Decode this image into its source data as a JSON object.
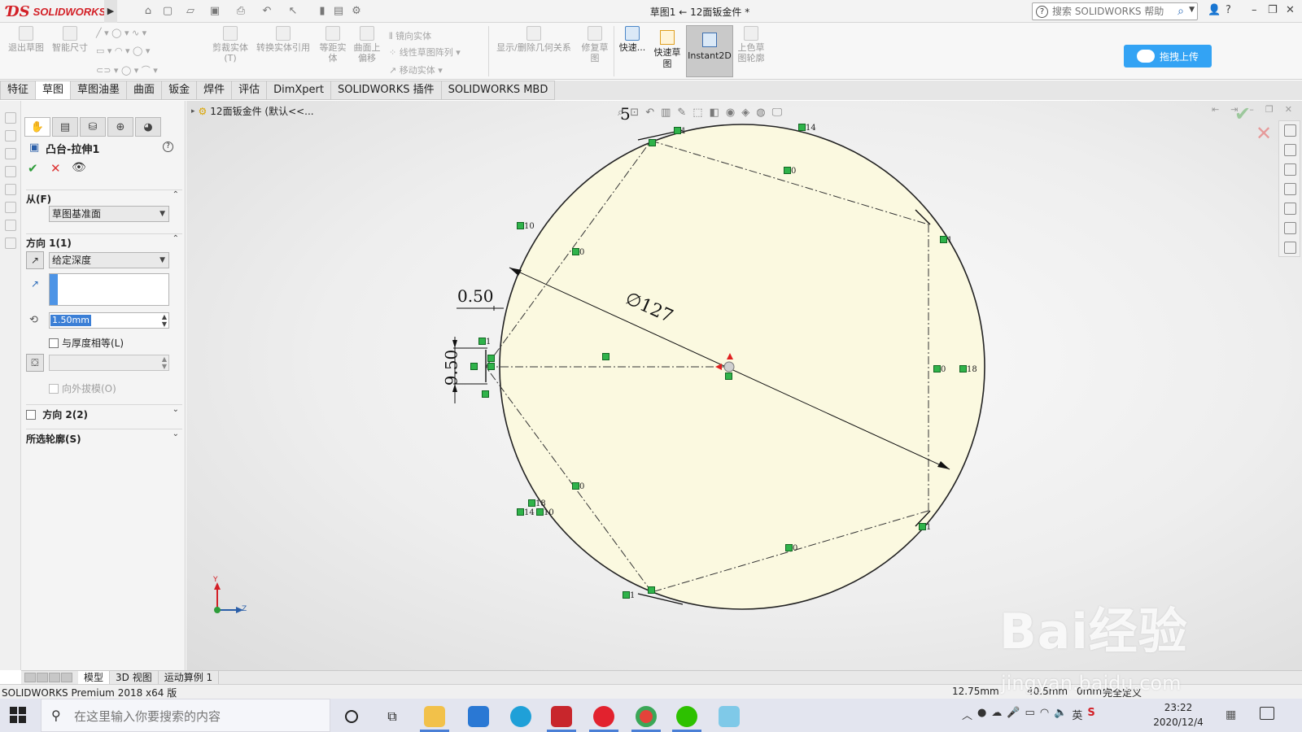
{
  "app": {
    "brand": "SOLIDWORKS",
    "document_title": "草图1 ← 12面钣金件 *",
    "help_search_placeholder": "搜索 SOLIDWORKS 帮助",
    "cloud_button": "拖拽上传"
  },
  "ribbon": {
    "exit_sketch": "退出草图",
    "smart_dimension": "智能尺寸",
    "trim_entities": "剪裁实体(T)",
    "convert_entities": "转换实体引用",
    "offset_entities": "等距实体",
    "offset_on_surface": "曲面上偏移",
    "mirror_entities": "镜向实体",
    "linear_pattern": "线性草图阵列",
    "move_entities": "移动实体",
    "display_relations": "显示/删除几何关系",
    "repair_sketch": "修复草图",
    "quick_snaps": "快速...",
    "rapid_sketch": "快速草图",
    "instant2d": "Instant2D",
    "shaded_contours": "上色草图轮廓"
  },
  "command_tabs": [
    "特征",
    "草图",
    "草图油墨",
    "曲面",
    "钣金",
    "焊件",
    "评估",
    "DimXpert",
    "SOLIDWORKS 插件",
    "SOLIDWORKS MBD"
  ],
  "active_command_tab": "草图",
  "property_manager": {
    "title": "凸台-拉伸1",
    "help_icon": "?",
    "from_label": "从(F)",
    "from_value": "草图基准面",
    "direction1_label": "方向 1(1)",
    "end_condition": "给定深度",
    "depth_value": "1.50mm",
    "equal_thickness_label": "与厚度相等(L)",
    "draft_outward_label": "向外拔模(O)",
    "direction2_label": "方向 2(2)",
    "selected_contours_label": "所选轮廓(S)"
  },
  "viewport": {
    "feature_tree_item": "12面钣金件 (默认<<...",
    "dim_top_count": "5",
    "dim_diameter": "∅127",
    "dim_offset": "0.50",
    "dim_height": "9.50",
    "relation_labels": {
      "r1": "1",
      "r14a": "14",
      "r0a": "0",
      "r10a": "10",
      "r0b": "0",
      "r1b": "1",
      "r1c": "1",
      "r0c": "0",
      "r18a": "18",
      "r0d": "0",
      "r18b": "18",
      "r14b": "14",
      "r10b": "10",
      "r0e": "0",
      "r1d": "1",
      "r1e": "1"
    },
    "triad": {
      "y": "Y",
      "z": "Z"
    }
  },
  "bottom_tabs": [
    "模型",
    "3D 视图",
    "运动算例 1"
  ],
  "active_bottom_tab": "模型",
  "status": {
    "product": "SOLIDWORKS Premium 2018 x64 版",
    "x": "12.75mm",
    "y": "40.5mm",
    "z": "0mm",
    "state": "完全定义"
  },
  "taskbar": {
    "search_placeholder": "在这里输入你要搜索的内容",
    "time": "23:22",
    "date": "2020/12/4",
    "ime": "英"
  },
  "watermark": {
    "text": "Bai经验",
    "url": "jingyan.baidu.com"
  },
  "colors": {
    "sketch_fill": "#fbf9e0",
    "relation_green": "#2fb34a",
    "accent_blue": "#33a3f4",
    "brand_red": "#d32027"
  }
}
